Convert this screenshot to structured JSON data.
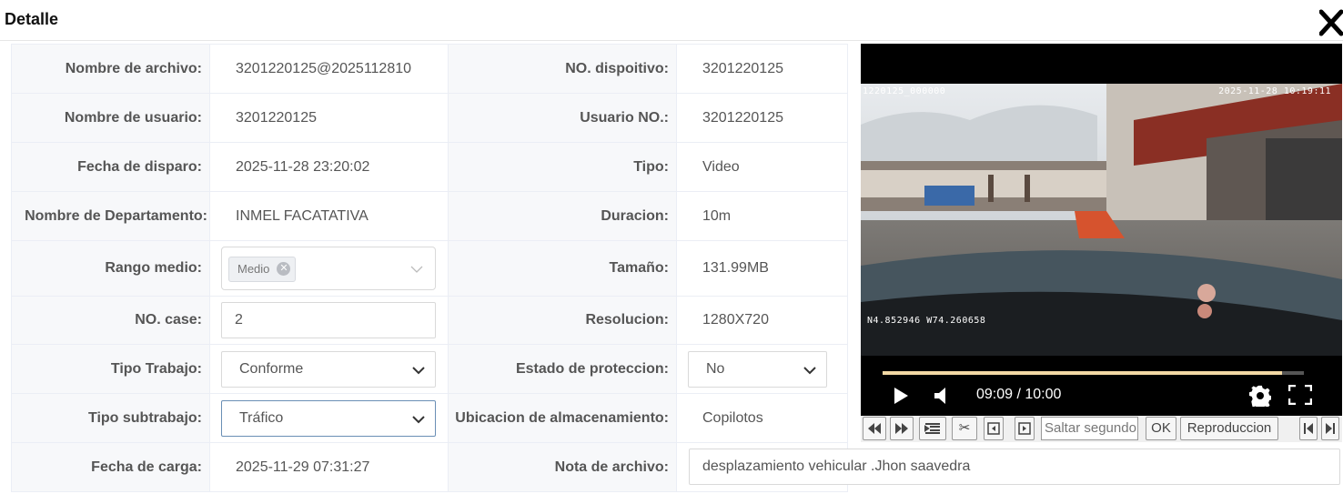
{
  "dialog": {
    "title": "Detalle",
    "close_icon": "close-x-icon"
  },
  "fields": {
    "nombre_archivo": {
      "label": "Nombre de archivo:",
      "value": "3201220125@2025112810"
    },
    "nombre_usuario": {
      "label": "Nombre de usuario:",
      "value": "3201220125"
    },
    "fecha_disparo": {
      "label": "Fecha de disparo:",
      "value": "2025-11-28 23:20:02"
    },
    "departamento": {
      "label": "Nombre de Departamento:",
      "value": "INMEL FACATATIVA"
    },
    "rango_medio": {
      "label": "Rango medio:",
      "tag": "Medio"
    },
    "no_case": {
      "label": "NO. case:",
      "value": "2"
    },
    "tipo_trabajo": {
      "label": "Tipo Trabajo:",
      "value": "Conforme"
    },
    "tipo_subtrabajo": {
      "label": "Tipo subtrabajo:",
      "value": "Tráfico"
    },
    "fecha_carga": {
      "label": "Fecha de carga:",
      "value": "2025-11-29 07:31:27"
    },
    "no_dispositivo": {
      "label": "NO. dispoitivo:",
      "value": "3201220125"
    },
    "usuario_no": {
      "label": "Usuario NO.:",
      "value": "3201220125"
    },
    "tipo": {
      "label": "Tipo:",
      "value": "Video"
    },
    "duracion": {
      "label": "Duracion:",
      "value": "10m"
    },
    "tamano": {
      "label": "Tamaño:",
      "value": "131.99MB"
    },
    "resolucion": {
      "label": "Resolucion:",
      "value": "1280X720"
    },
    "estado_proteccion": {
      "label": "Estado de proteccion:",
      "value": "No"
    },
    "ubicacion": {
      "label": "Ubicacion de almacenamiento:",
      "value": "Copilotos"
    },
    "nota_archivo": {
      "label": "Nota de archivo:",
      "value": "desplazamiento vehicular .Jhon saavedra"
    }
  },
  "player": {
    "osd_top_left": "1220125_000000",
    "osd_top_right": "2025-11-28 10:19:11",
    "osd_gps": "N4.852946 W74.260658",
    "time": "09:09 / 10:00",
    "progress_fraction": 0.948,
    "colors": {
      "progress": "#f3d9a4",
      "background": "#000000"
    }
  },
  "toolbar": {
    "skip_placeholder": "Saltar segundo",
    "ok_label": "OK",
    "playback_label": "Reproduccion",
    "icons": [
      "rewind-icon",
      "fast-forward-icon",
      "list-icon",
      "scissors-icon",
      "prev-frame-icon",
      "next-frame-icon",
      "skip-start-icon",
      "skip-end-icon"
    ]
  }
}
